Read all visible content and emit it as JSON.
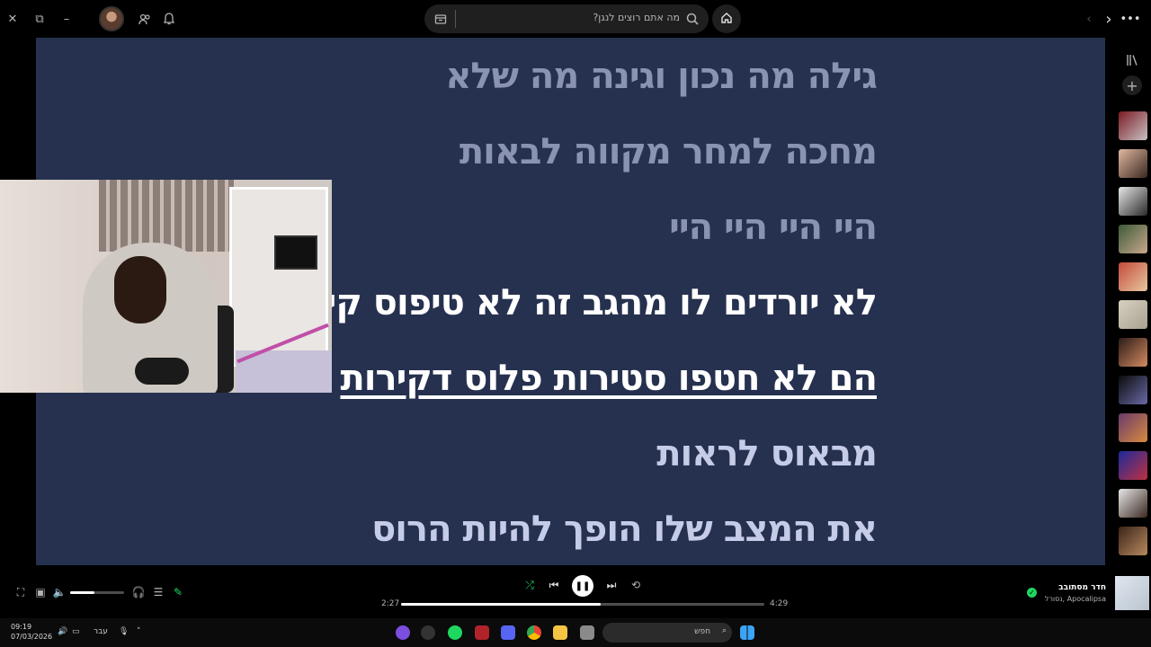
{
  "topbar": {
    "search_placeholder": "מה אתם רוצים לנגן?",
    "icons": [
      "close-icon",
      "restore-icon",
      "minimize-icon",
      "friends-icon",
      "bell-icon",
      "browse-icon",
      "search-icon",
      "home-icon",
      "back-icon",
      "forward-icon",
      "more-icon"
    ]
  },
  "lyrics": {
    "lines": [
      {
        "text": "גילה מה נכון וגינה מה שלא",
        "state": "past"
      },
      {
        "text": "מחכה למחר מקווה לבאות",
        "state": "past"
      },
      {
        "text": "היי היי היי היי",
        "state": "past"
      },
      {
        "text": "לא יורדים לו מהגב זה לא טיפוס קירות",
        "state": "active"
      },
      {
        "text": "הם לא חטפו סטירות פלוס דקירות",
        "state": "active-hover"
      },
      {
        "text": "מבאוס לראות",
        "state": "future"
      },
      {
        "text": "את המצב שלו הופך להיות הרוס",
        "state": "future"
      }
    ]
  },
  "player": {
    "elapsed": "2:27",
    "duration": "4:29",
    "progress_fraction": 0.55,
    "volume_fraction": 0.45,
    "now_playing_title": "חדר מסתובב",
    "now_playing_artist": "Apocalipsa ,נסורל"
  },
  "taskbar": {
    "time": "09:19",
    "date": "07/03/2026",
    "language": "עבר",
    "search_label": "חפש"
  },
  "colors": {
    "lyrics_bg": "#26314f",
    "accent_green": "#1ed760"
  }
}
